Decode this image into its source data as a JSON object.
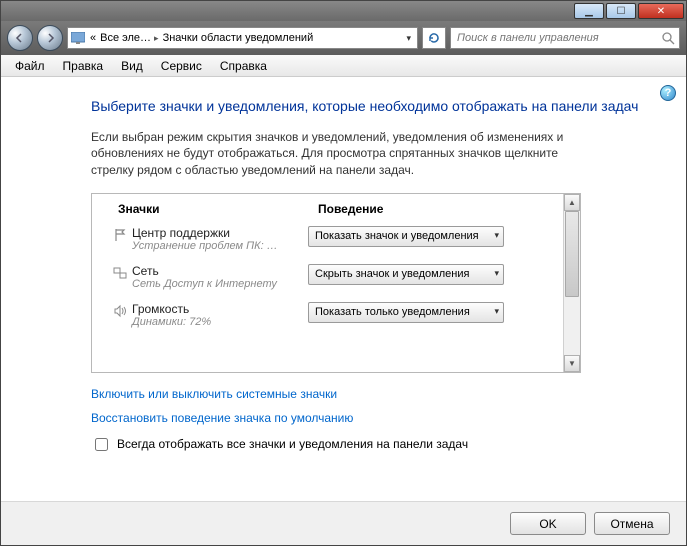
{
  "breadcrumb": {
    "item1": "Все эле…",
    "item2": "Значки области уведомлений"
  },
  "search": {
    "placeholder": "Поиск в панели управления"
  },
  "menu": {
    "file": "Файл",
    "edit": "Правка",
    "view": "Вид",
    "tools": "Сервис",
    "help": "Справка"
  },
  "heading": "Выберите значки и уведомления, которые необходимо отображать на панели задач",
  "description": "Если выбран режим скрытия значков и уведомлений, уведомления об изменениях и обновлениях не будут отображаться. Для просмотра спрятанных значков щелкните стрелку рядом с областью уведомлений на панели задач.",
  "columns": {
    "icons": "Значки",
    "behavior": "Поведение"
  },
  "rows": [
    {
      "icon": "flag-icon",
      "name": "Центр поддержки",
      "sub": "Устранение проблем ПК: …",
      "value": "Показать значок и уведомления"
    },
    {
      "icon": "network-icon",
      "name": "Сеть",
      "sub": "Сеть Доступ к Интернету",
      "value": "Скрыть значок и уведомления"
    },
    {
      "icon": "volume-icon",
      "name": "Громкость",
      "sub": "Динамики: 72%",
      "value": "Показать только уведомления"
    }
  ],
  "links": {
    "system_icons": "Включить или выключить системные значки",
    "restore_defaults": "Восстановить поведение значка по умолчанию"
  },
  "checkbox_label": "Всегда отображать все значки и уведомления на панели задач",
  "buttons": {
    "ok": "OK",
    "cancel": "Отмена"
  }
}
